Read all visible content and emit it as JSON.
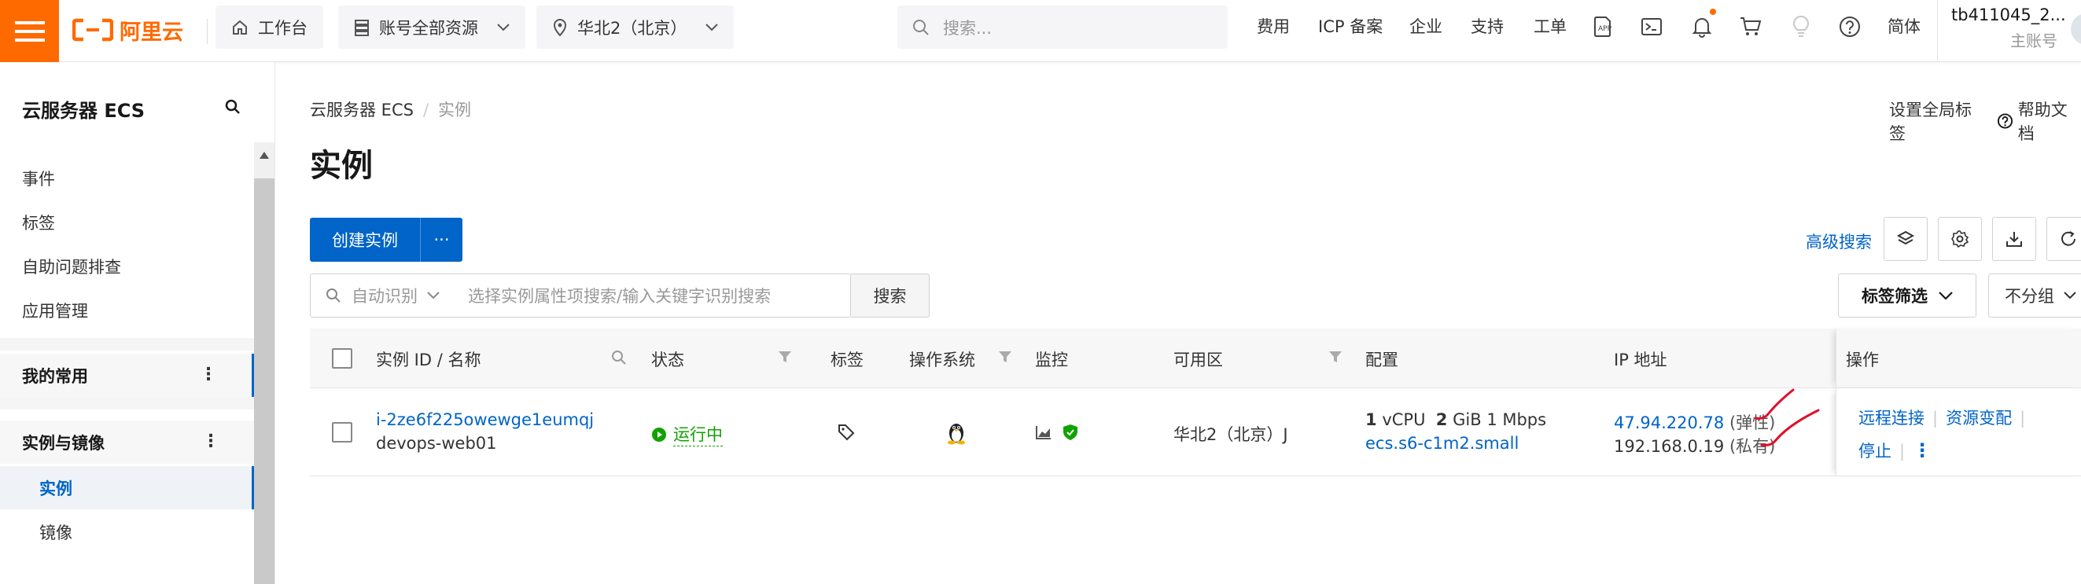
{
  "topbar": {
    "brand": "阿里云",
    "workbench": "工作台",
    "resources": "账号全部资源",
    "region": "华北2（北京）",
    "search_placeholder": "搜索...",
    "links": [
      "费用",
      "ICP 备案",
      "企业",
      "支持",
      "工单"
    ],
    "language": "简体",
    "account_name": "tb411045_2...",
    "account_type": "主账号",
    "colors": {
      "brand": "#ff6a00",
      "primary": "#0064c8"
    }
  },
  "sidebar": {
    "title": "云服务器 ECS",
    "items": [
      "事件",
      "标签",
      "自助问题排查",
      "应用管理"
    ],
    "groups": [
      {
        "label": "我的常用",
        "more": "⋮"
      },
      {
        "label": "实例与镜像",
        "more": "⋮"
      }
    ],
    "subitems": [
      "实例",
      "镜像"
    ]
  },
  "main": {
    "breadcrumb": [
      "云服务器 ECS",
      "实例"
    ],
    "breadcrumb_sep": "/",
    "top_links": [
      "设置全局标签",
      "帮助文档"
    ],
    "title": "实例",
    "create_button": "创建实例",
    "create_more": "···",
    "advanced_search": "高级搜索",
    "filter": {
      "selector": "自动识别",
      "placeholder": "选择实例属性项搜索/输入关键字识别搜索",
      "search_button": "搜索"
    },
    "tag_filter": "标签筛选",
    "group_select": "不分组"
  },
  "table": {
    "columns": [
      "实例 ID / 名称",
      "状态",
      "标签",
      "操作系统",
      "监控",
      "可用区",
      "配置",
      "IP 地址",
      "操作"
    ],
    "rows": [
      {
        "instance_id": "i-2ze6f225owewge1eumqj",
        "name": "devops-web01",
        "status": "运行中",
        "zone": "华北2（北京）J",
        "cpu_num": "1",
        "cpu_unit": "vCPU",
        "mem_num": "2",
        "mem_unit": "GiB",
        "bandwidth": "1 Mbps",
        "spec": "ecs.s6-c1m2.small",
        "public_ip": "47.94.220.78",
        "public_ip_type": "(弹性)",
        "private_ip": "192.168.0.19",
        "private_ip_type": "(私有)",
        "actions": [
          "远程连接",
          "资源变配",
          "停止"
        ],
        "more": "⋮"
      }
    ]
  }
}
